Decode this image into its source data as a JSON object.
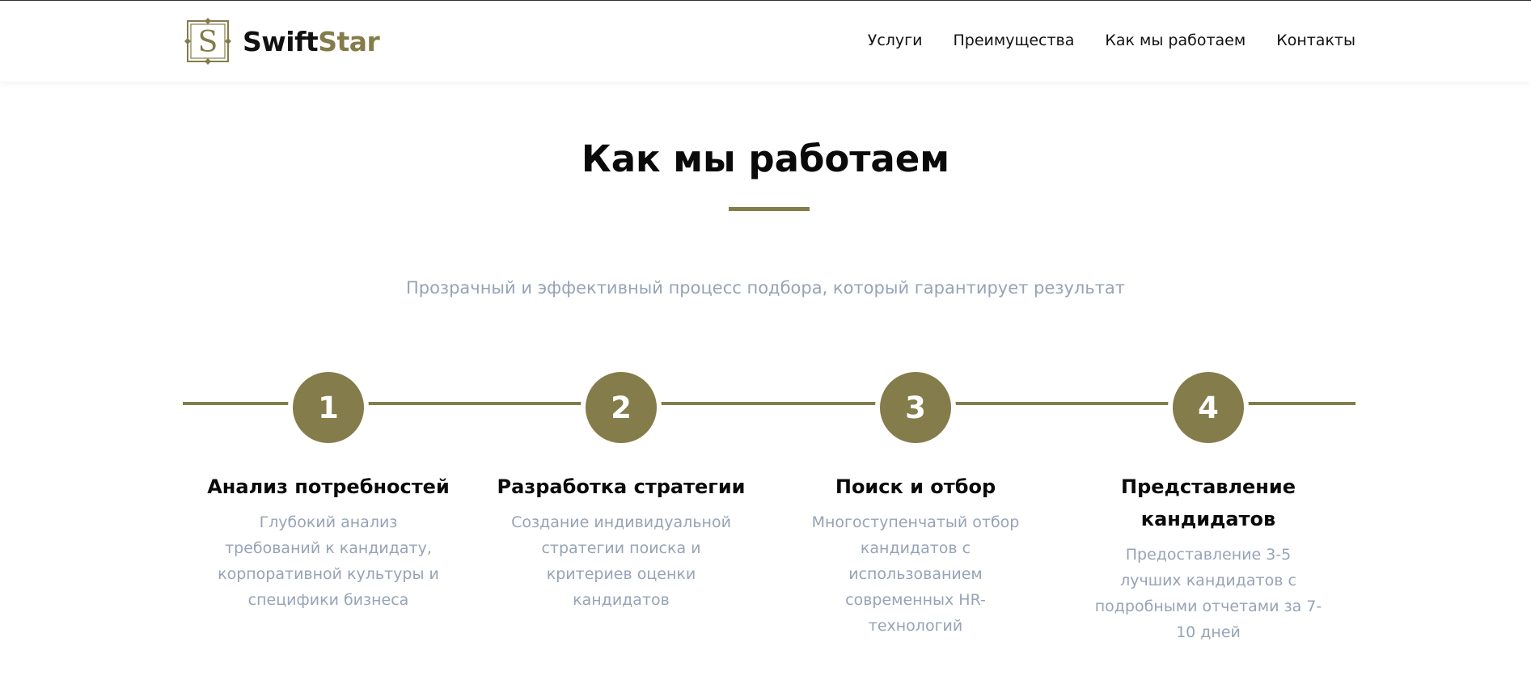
{
  "header": {
    "brand_part1": "Swift",
    "brand_part2": "Star",
    "logo_letter": "S",
    "nav": [
      "Услуги",
      "Преимущества",
      "Как мы работаем",
      "Контакты"
    ]
  },
  "section": {
    "title": "Как мы работаем",
    "subtitle": "Прозрачный и эффективный процесс подбора, который гарантирует результат"
  },
  "steps": [
    {
      "number": "1",
      "title": "Анализ потребностей",
      "description": "Глубокий анализ требований к кандидату, корпоративной культуры и специфики бизнеса"
    },
    {
      "number": "2",
      "title": "Разработка стратегии",
      "description": "Создание индивидуальной стратегии поиска и критериев оценки кандидатов"
    },
    {
      "number": "3",
      "title": "Поиск и отбор",
      "description": "Многоступенчатый отбор кандидатов с использованием современных HR-технологий"
    },
    {
      "number": "4",
      "title": "Представление кандидатов",
      "description": "Предоставление 3-5 лучших кандидатов с подробными отчетами за 7-10 дней"
    }
  ],
  "colors": {
    "accent": "#847c4a",
    "muted_text": "#97a3b6",
    "heading": "#0a0a0a"
  }
}
